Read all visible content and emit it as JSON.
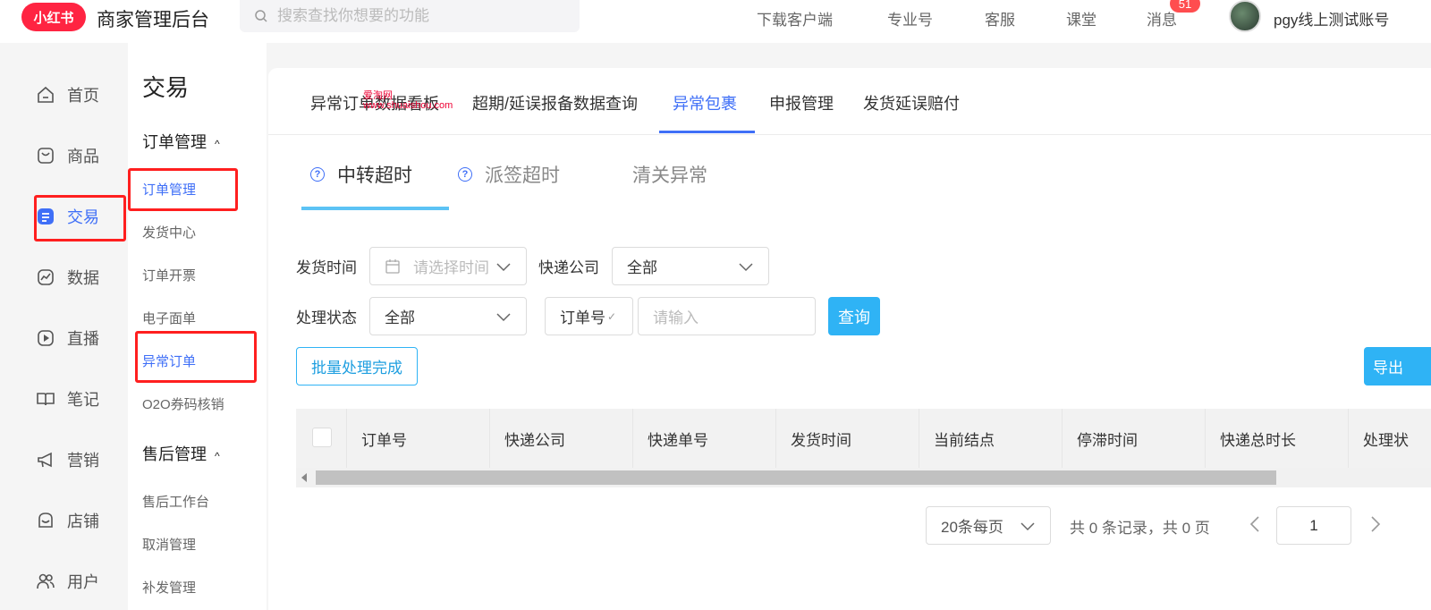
{
  "header": {
    "logo_text": "小红书",
    "app_title": "商家管理后台",
    "search_placeholder": "搜索查找你想要的功能",
    "nav": [
      "下载客户端",
      "专业号",
      "客服",
      "课堂",
      "消息"
    ],
    "message_count": "51",
    "username": "pgy线上测试账号"
  },
  "sidebar": {
    "items": [
      {
        "label": "首页",
        "icon": "home-icon"
      },
      {
        "label": "商品",
        "icon": "bag-icon"
      },
      {
        "label": "交易",
        "icon": "trade-icon",
        "active": true
      },
      {
        "label": "数据",
        "icon": "chart-icon"
      },
      {
        "label": "直播",
        "icon": "live-icon"
      },
      {
        "label": "笔记",
        "icon": "book-icon"
      },
      {
        "label": "营销",
        "icon": "megaphone-icon"
      },
      {
        "label": "店铺",
        "icon": "store-icon"
      },
      {
        "label": "用户",
        "icon": "users-icon"
      }
    ]
  },
  "subnav": {
    "title": "交易",
    "group1": "订单管理",
    "group1_items": [
      "订单管理",
      "发货中心",
      "订单开票",
      "电子面单",
      "异常订单",
      "O2O券码核销"
    ],
    "group2": "售后管理",
    "group2_items": [
      "售后工作台",
      "取消管理",
      "补发管理"
    ]
  },
  "tabs": [
    "异常订单数据看板",
    "超期/延误报备数据查询",
    "异常包裹",
    "申报管理",
    "发货延误赔付"
  ],
  "active_tab": "异常包裹",
  "watermark": {
    "line1": "爱淘网",
    "line2": "www.shuaishou.com"
  },
  "subtabs": [
    "中转超时",
    "派签超时",
    "清关异常"
  ],
  "filters": {
    "ship_time_label": "发货时间",
    "ship_time_placeholder": "请选择时间",
    "courier_label": "快递公司",
    "courier_value": "全部",
    "status_label": "处理状态",
    "status_value": "全部",
    "order_type": "订单号",
    "order_placeholder": "请输入",
    "query_button": "查询"
  },
  "actions": {
    "batch": "批量处理完成",
    "export": "导出"
  },
  "table": {
    "columns": [
      "订单号",
      "快递公司",
      "快递单号",
      "发货时间",
      "当前结点",
      "停滞时间",
      "快递总时长",
      "处理状"
    ]
  },
  "pagination": {
    "page_size": "20条每页",
    "summary": "共 0 条记录，共 0 页",
    "current_page": "1"
  },
  "colors": {
    "brand": "#ff2442",
    "active": "#3f6ff7",
    "primary_btn": "#2fb3f5"
  }
}
